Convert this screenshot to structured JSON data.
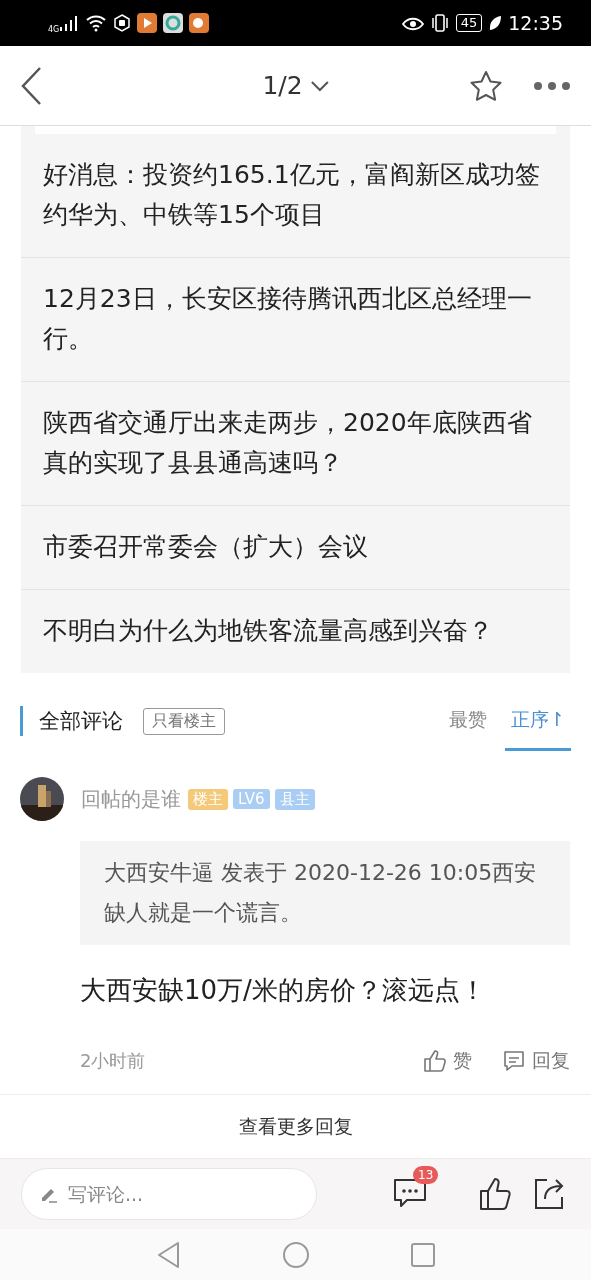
{
  "status_bar": {
    "network": "4G",
    "battery": "45",
    "time": "12:35"
  },
  "header": {
    "page": "1/2"
  },
  "articles": [
    {
      "title": "好消息：投资约165.1亿元，富阎新区成功签约华为、中铁等15个项目"
    },
    {
      "title": "12月23日，长安区接待腾讯西北区总经理一行。"
    },
    {
      "title": "陕西省交通厅出来走两步，2020年底陕西省真的实现了县县通高速吗？"
    },
    {
      "title": "市委召开常委会（扩大）会议"
    },
    {
      "title": "不明白为什么为地铁客流量高感到兴奋？"
    }
  ],
  "comments_header": {
    "title": "全部评论",
    "filter": "只看楼主",
    "sorts": [
      {
        "label": "最赞",
        "selected": false
      },
      {
        "label": "正序↾",
        "selected": true
      }
    ]
  },
  "comment": {
    "author": "回帖的是谁",
    "badges": [
      {
        "label": "楼主",
        "color": "#f5c97a"
      },
      {
        "label": "LV6",
        "color": "#a9cdf3"
      },
      {
        "label": "县主",
        "color": "#a9cdf3"
      }
    ],
    "quote": "大西安牛逼 发表于 2020-12-26 10:05西安缺人就是一个谎言。",
    "text": "大西安缺10万/米的房价？滚远点！",
    "time": "2小时前",
    "like": "赞",
    "reply": "回复"
  },
  "more_replies": "查看更多回复",
  "bottom_bar": {
    "placeholder": "写评论...",
    "comment_count": "13"
  }
}
